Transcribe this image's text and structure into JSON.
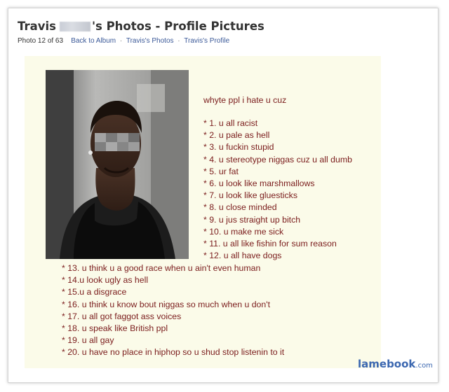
{
  "header": {
    "title_name": "Travis",
    "title_suffix": "'s Photos - Profile Pictures"
  },
  "subline": {
    "photo_count": "Photo 12 of 63",
    "links": [
      "Back to Album",
      "Travis's Photos",
      "Travis's Profile"
    ]
  },
  "post": {
    "intro": "whyte ppl i hate u cuz",
    "items": [
      "* 1. u all racist",
      "* 2. u pale as hell",
      "* 3. u fuckin stupid",
      "* 4. u stereotype niggas cuz u all dumb",
      "* 5. ur fat",
      "* 6. u look like marshmallows",
      "* 7. u look like gluesticks",
      "* 8. u close minded",
      "* 9. u jus straight up bitch",
      "* 10. u make me sick",
      "* 11. u all like fishin for sum reason",
      "* 12. u all have dogs",
      "* 13. u think u a good race when u ain't even human",
      "* 14.u look ugly as hell",
      "* 15.u a disgrace",
      "* 16. u think u know bout niggas so much when u don't",
      "* 17. u all got faggot ass voices",
      "* 18. u speak like British ppl",
      "* 19. u all gay",
      "* 20. u have no place in hiphop so u shud stop listenin to it"
    ]
  },
  "watermark": {
    "name": "lamebook",
    "domain": ".com"
  },
  "colors": {
    "link": "#3b5998",
    "post_text": "#7a1c1c",
    "photo_bg": "#fbfbe9",
    "watermark": "#3b67b0"
  }
}
